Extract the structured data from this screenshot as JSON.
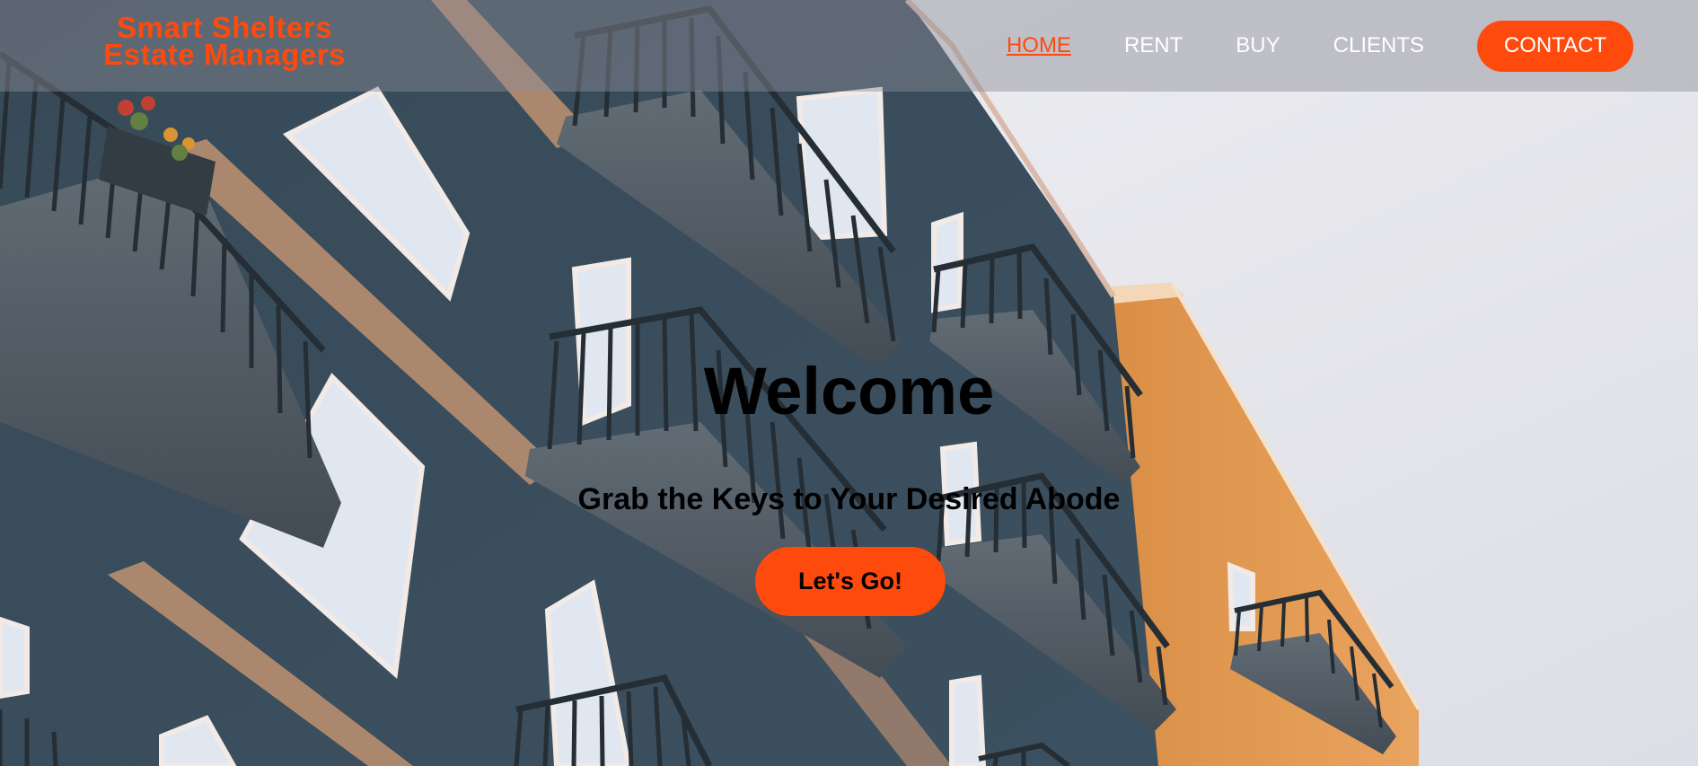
{
  "brand": {
    "line1": "Smart Shelters",
    "line2": "Estate Managers",
    "color": "#ff4a0d"
  },
  "nav": {
    "items": [
      {
        "label": "HOME",
        "active": true
      },
      {
        "label": "RENT",
        "active": false
      },
      {
        "label": "BUY",
        "active": false
      },
      {
        "label": "CLIENTS",
        "active": false
      }
    ],
    "contact_label": "CONTACT"
  },
  "hero": {
    "title": "Welcome",
    "subtitle": "Grab the Keys to Your Desired Abode",
    "cta_label": "Let's Go!",
    "background": "apartment-building-photo"
  },
  "colors": {
    "accent": "#ff4a0d",
    "nav_text": "#ffffff",
    "heading_text": "#000000"
  }
}
